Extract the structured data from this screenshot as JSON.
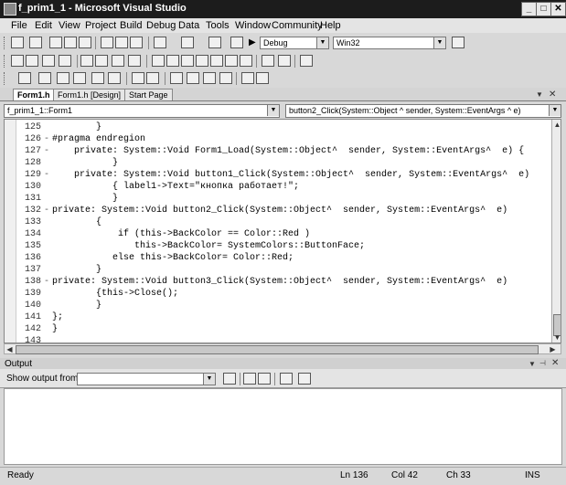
{
  "window": {
    "title": "f_prim1_1 - Microsoft Visual Studio"
  },
  "menu": [
    "File",
    "Edit",
    "View",
    "Project",
    "Build",
    "Debug",
    "Data",
    "Tools",
    "Window",
    "Community",
    "Help"
  ],
  "toolbar": {
    "config": "Debug",
    "platform": "Win32"
  },
  "tabs": [
    "Form1.h",
    "Form1.h [Design]",
    "Start Page"
  ],
  "nav": {
    "left": "f_prim1_1::Form1",
    "right": "button2_Click(System::Object ^ sender, System::EventArgs ^ e)"
  },
  "code": [
    {
      "n": "125",
      "f": "",
      "t": "        }"
    },
    {
      "n": "126",
      "f": "-",
      "t": "#pragma endregion"
    },
    {
      "n": "127",
      "f": "-",
      "t": "    private: System::Void Form1_Load(System::Object^  sender, System::EventArgs^  e) {"
    },
    {
      "n": "128",
      "f": "",
      "t": "           }"
    },
    {
      "n": "129",
      "f": "-",
      "t": "    private: System::Void button1_Click(System::Object^  sender, System::EventArgs^  e)"
    },
    {
      "n": "130",
      "f": "",
      "t": "           { label1->Text=\"кнопка работает!\";"
    },
    {
      "n": "131",
      "f": "",
      "t": "           }"
    },
    {
      "n": "132",
      "f": "-",
      "t": "private: System::Void button2_Click(System::Object^  sender, System::EventArgs^  e)"
    },
    {
      "n": "133",
      "f": "",
      "t": "        {"
    },
    {
      "n": "134",
      "f": "",
      "t": "            if (this->BackColor == Color::Red )"
    },
    {
      "n": "135",
      "f": "",
      "t": "               this->BackColor= SystemColors::ButtonFace;"
    },
    {
      "n": "136",
      "f": "",
      "t": "           else this->BackColor= Color::Red;"
    },
    {
      "n": "137",
      "f": "",
      "t": "        }"
    },
    {
      "n": "138",
      "f": "-",
      "t": "private: System::Void button3_Click(System::Object^  sender, System::EventArgs^  e)"
    },
    {
      "n": "139",
      "f": "",
      "t": "        {this->Close();"
    },
    {
      "n": "140",
      "f": "",
      "t": "        }"
    },
    {
      "n": "141",
      "f": "",
      "t": "};"
    },
    {
      "n": "142",
      "f": "",
      "t": "}"
    },
    {
      "n": "143",
      "f": "",
      "t": ""
    }
  ],
  "output": {
    "title": "Output",
    "show_label": "Show output from:"
  },
  "status": {
    "ready": "Ready",
    "ln": "Ln 136",
    "col": "Col 42",
    "ch": "Ch 33",
    "mode": "INS"
  }
}
